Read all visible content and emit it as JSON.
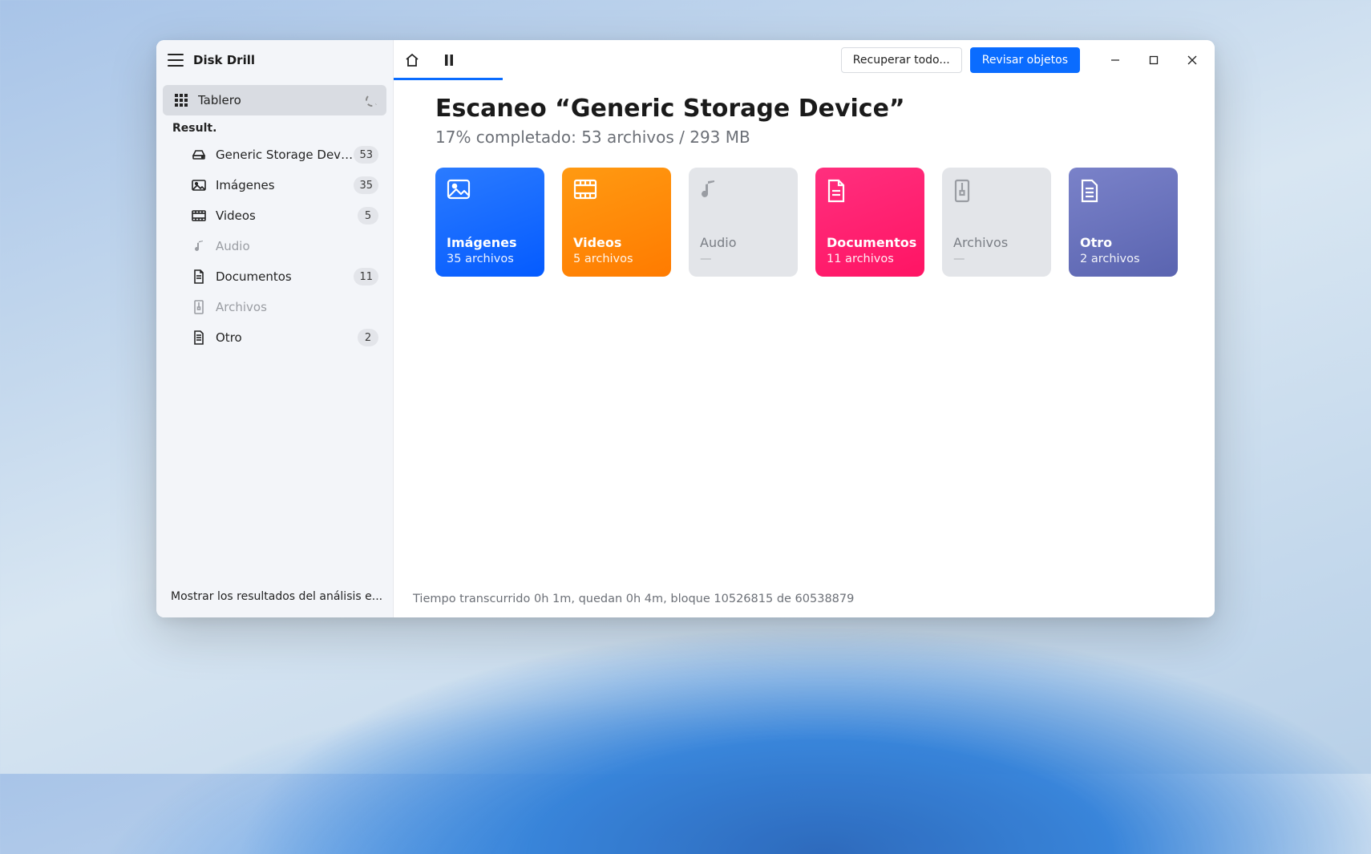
{
  "app": {
    "title": "Disk Drill"
  },
  "sidebar": {
    "tablero_label": "Tablero",
    "section_label": "Result.",
    "items": [
      {
        "label": "Generic Storage Device",
        "badge": "53"
      },
      {
        "label": "Imágenes",
        "badge": "35"
      },
      {
        "label": "Videos",
        "badge": "5"
      },
      {
        "label": "Audio",
        "badge": ""
      },
      {
        "label": "Documentos",
        "badge": "11"
      },
      {
        "label": "Archivos",
        "badge": ""
      },
      {
        "label": "Otro",
        "badge": "2"
      }
    ],
    "footer_link": "Mostrar los resultados del análisis e..."
  },
  "toolbar": {
    "recover_label": "Recuperar todo...",
    "review_label": "Revisar objetos"
  },
  "main": {
    "title": "Escaneo “Generic Storage Device”",
    "subtitle": "17% completado: 53 archivos / 293 MB",
    "cards": [
      {
        "title": "Imágenes",
        "sub": "35 archivos"
      },
      {
        "title": "Videos",
        "sub": "5 archivos"
      },
      {
        "title": "Audio",
        "sub": "—"
      },
      {
        "title": "Documentos",
        "sub": "11 archivos"
      },
      {
        "title": "Archivos",
        "sub": "—"
      },
      {
        "title": "Otro",
        "sub": "2 archivos"
      }
    ],
    "footer_status": "Tiempo transcurrido 0h 1m, quedan 0h 4m, bloque 10526815 de 60538879"
  }
}
